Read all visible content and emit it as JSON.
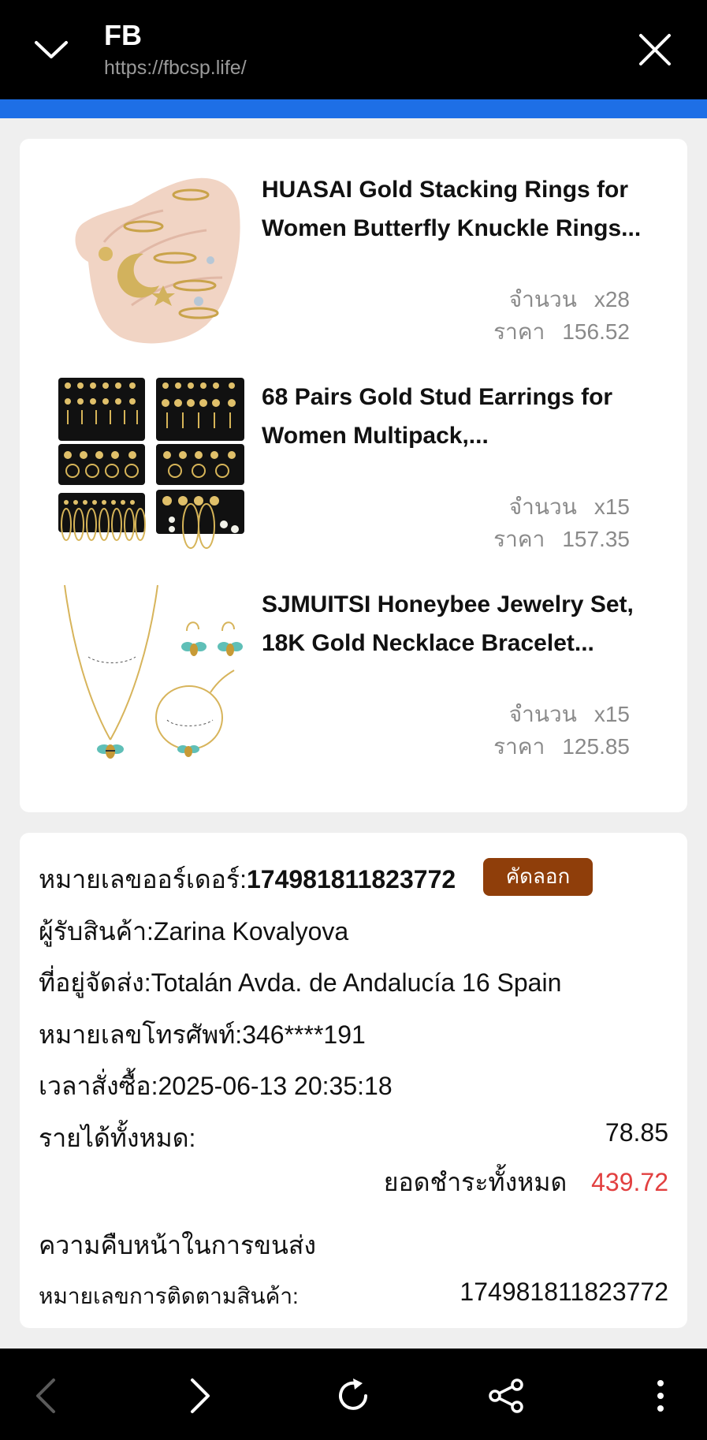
{
  "browser": {
    "title": "FB",
    "url": "https://fbcsp.life/",
    "progress_color": "#1e6fe6"
  },
  "products": [
    {
      "name_line1": "HUASAI Gold Stacking Rings for",
      "name_line2": "Women Butterfly Knuckle Rings...",
      "qty_label": "จำนวน",
      "qty": "x28",
      "price_label": "ราคา",
      "price": "156.52",
      "image": "rings-on-hand-image"
    },
    {
      "name_line1": "68 Pairs Gold Stud Earrings for",
      "name_line2": "Women Multipack,...",
      "qty_label": "จำนวน",
      "qty": "x15",
      "price_label": "ราคา",
      "price": "157.35",
      "image": "earrings-multipack-image"
    },
    {
      "name_line1": "SJMUITSI Honeybee Jewelry Set,",
      "name_line2": "18K Gold Necklace Bracelet...",
      "qty_label": "จำนวน",
      "qty": "x15",
      "price_label": "ราคา",
      "price": "125.85",
      "image": "honeybee-jewelry-set-image"
    }
  ],
  "order": {
    "number_label": "หมายเลขออร์เดอร์:",
    "number": "174981811823772",
    "copy_label": "คัดลอก",
    "copy_color": "#8f3e0a",
    "recipient": "ผู้รับสินค้า:Zarina Kovalyova",
    "address": "ที่อยู่จัดส่ง:Totalán Avda. de Andalucía 16 Spain",
    "phone": "หมายเลขโทรศัพท์:346****191",
    "time": "เวลาสั่งซื้อ:2025-06-13 20:35:18",
    "income_label": "รายได้ทั้งหมด:",
    "income": "78.85",
    "total_label": "ยอดชำระทั้งหมด",
    "total": "439.72",
    "total_color": "#e24040",
    "shipping_heading": "ความคืบหน้าในการขนส่ง",
    "tracking_label": "หมายเลขการติดตามสินค้า:",
    "tracking": "174981811823772"
  },
  "icons": {
    "top_left": "chevron-down-icon",
    "top_right": "close-icon",
    "nav": [
      "back-arrow-icon",
      "forward-arrow-icon",
      "refresh-icon",
      "share-icon",
      "more-vertical-icon"
    ]
  }
}
